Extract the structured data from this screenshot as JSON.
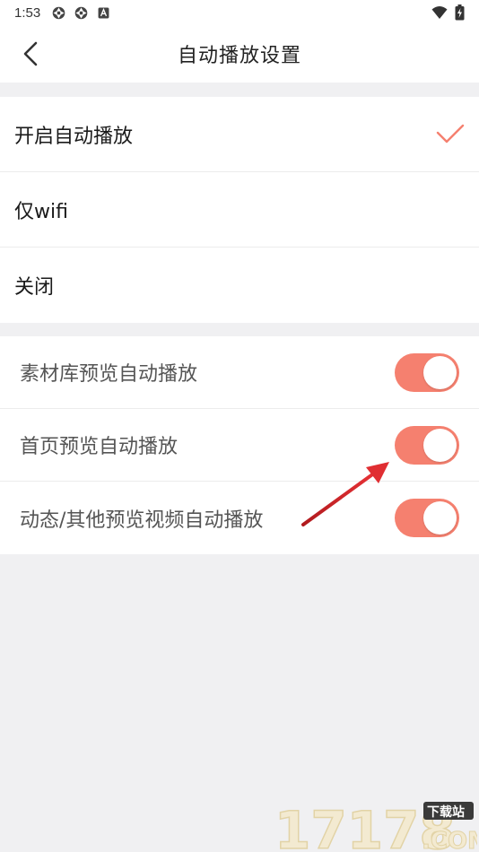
{
  "status_bar": {
    "time": "1:53",
    "icons": [
      "settings-gear-icon",
      "settings-gear-icon",
      "a-badge-icon",
      "wifi-icon",
      "battery-icon"
    ]
  },
  "header": {
    "title": "自动播放设置",
    "back_icon": "chevron-left-icon"
  },
  "autoplay_options": [
    {
      "label": "开启自动播放",
      "selected": true
    },
    {
      "label": "仅wifi",
      "selected": false
    },
    {
      "label": "关闭",
      "selected": false
    }
  ],
  "preview_switches": [
    {
      "label": "素材库预览自动播放",
      "on": true
    },
    {
      "label": "首页预览自动播放",
      "on": true
    },
    {
      "label": "动态/其他预览视频自动播放",
      "on": true
    }
  ],
  "colors": {
    "accent": "#f5806f",
    "annotation_arrow": "#d9262a",
    "background": "#f0f0f2"
  },
  "watermark": {
    "brand": "17178",
    "domain": ".COM",
    "tag": "下载站"
  }
}
